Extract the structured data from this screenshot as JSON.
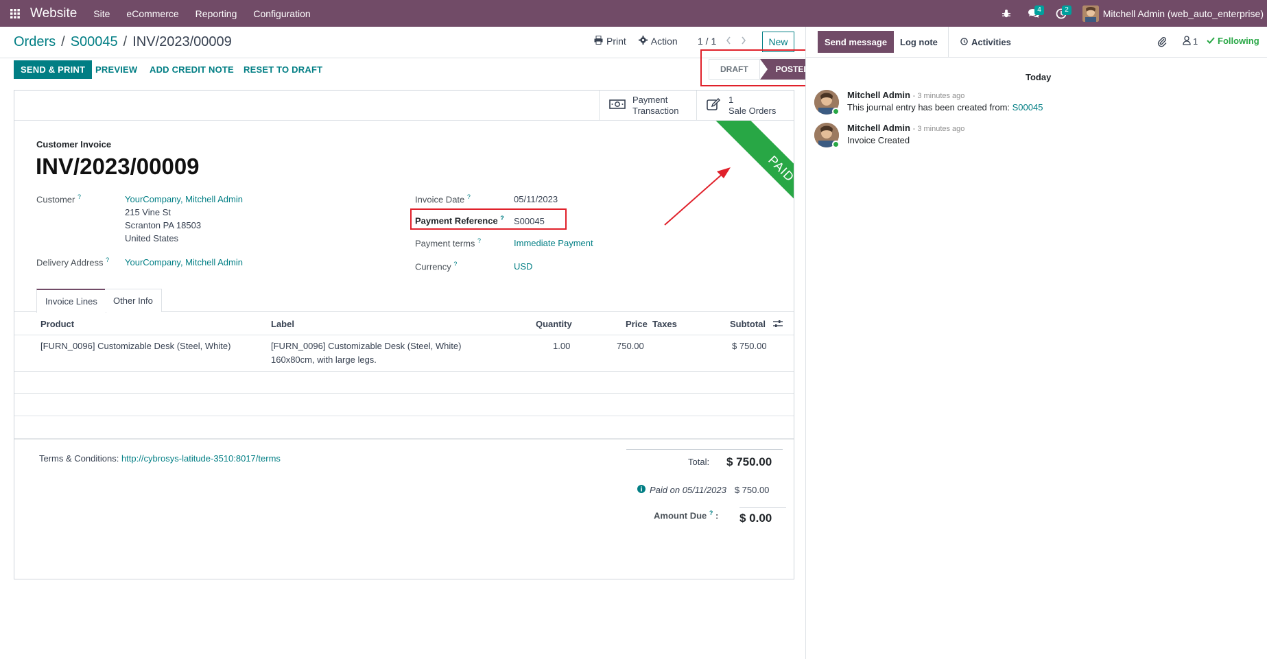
{
  "navbar": {
    "brand": "Website",
    "menus": [
      "Site",
      "eCommerce",
      "Reporting",
      "Configuration"
    ],
    "messages_count": "4",
    "activities_count": "2",
    "user": "Mitchell Admin (web_auto_enterprise)"
  },
  "breadcrumbs": {
    "root": "Orders",
    "parent": "S00045",
    "current": "INV/2023/00009"
  },
  "control": {
    "print": "Print",
    "action": "Action",
    "pager": "1 / 1",
    "new": "New"
  },
  "statusbar": {
    "send_print": "SEND & PRINT",
    "preview": "PREVIEW",
    "add_credit_note": "ADD CREDIT NOTE",
    "reset_to_draft": "RESET TO DRAFT",
    "stages": [
      "DRAFT",
      "POSTED"
    ],
    "active_stage": "POSTED"
  },
  "smart_buttons": {
    "payment": {
      "line1": "Payment",
      "line2": "Transaction"
    },
    "sale_orders": {
      "count": "1",
      "label": "Sale Orders"
    }
  },
  "ribbon": "PAID",
  "invoice": {
    "type": "Customer Invoice",
    "number": "INV/2023/00009",
    "customer_label": "Customer",
    "customer": "YourCompany, Mitchell Admin",
    "address": [
      "215 Vine St",
      "Scranton PA 18503",
      "United States"
    ],
    "delivery_label": "Delivery Address",
    "delivery": "YourCompany, Mitchell Admin",
    "invoice_date_label": "Invoice Date",
    "invoice_date": "05/11/2023",
    "payment_ref_label": "Payment Reference",
    "payment_ref": "S00045",
    "payment_terms_label": "Payment terms",
    "payment_terms": "Immediate Payment",
    "currency_label": "Currency",
    "currency": "USD",
    "help_mark": "?"
  },
  "tabs": [
    "Invoice Lines",
    "Other Info"
  ],
  "table": {
    "headers": [
      "Product",
      "Label",
      "Quantity",
      "Price",
      "Taxes",
      "Subtotal"
    ],
    "rows": [
      {
        "product": "[FURN_0096] Customizable Desk (Steel, White)",
        "label1": "[FURN_0096] Customizable Desk (Steel, White)",
        "label2": "160x80cm, with large legs.",
        "quantity": "1.00",
        "price": "750.00",
        "taxes": "",
        "subtotal": "$ 750.00"
      }
    ]
  },
  "footer": {
    "terms_label": "Terms & Conditions:",
    "terms_link": "http://cybrosys-latitude-3510:8017/terms",
    "total_label": "Total:",
    "total": "$ 750.00",
    "paid_on": "Paid on 05/11/2023",
    "paid_amount": "$ 750.00",
    "amount_due_label": "Amount Due",
    "amount_due_colon": ":",
    "amount_due": "$ 0.00"
  },
  "chatter": {
    "send_message": "Send message",
    "log_note": "Log note",
    "activities": "Activities",
    "followers": "1",
    "following": "Following",
    "today": "Today",
    "messages": [
      {
        "author": "Mitchell Admin",
        "time": "- 3 minutes ago",
        "body": "This journal entry has been created from:",
        "link": "S00045"
      },
      {
        "author": "Mitchell Admin",
        "time": "- 3 minutes ago",
        "body": "Invoice Created",
        "link": ""
      }
    ]
  },
  "colors": {
    "brand": "#714b67",
    "accent": "#017e84",
    "paid": "#28a745",
    "highlight": "#e0202a"
  }
}
